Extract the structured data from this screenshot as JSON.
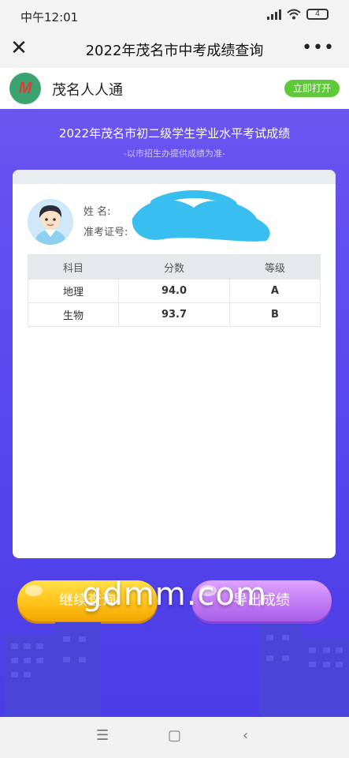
{
  "status_bar": {
    "time": "中午12:01",
    "battery": "4"
  },
  "nav": {
    "title": "2022年茂名市中考成绩查询",
    "more": "•••"
  },
  "app_banner": {
    "logo_text": "M",
    "app_name": "茂名人人通",
    "open_label": "立即打开"
  },
  "header": {
    "title": "2022年茂名市初二级学生学业水平考试成绩",
    "subtitle": "-以市招生办提供成绩为准-"
  },
  "student": {
    "name_label": "姓      名:",
    "id_label": "准考证号:"
  },
  "table": {
    "columns": [
      "科目",
      "分数",
      "等级"
    ],
    "rows": [
      [
        "地理",
        "94.0",
        "A"
      ],
      [
        "生物",
        "93.7",
        "B"
      ]
    ]
  },
  "buttons": {
    "continue_label": "继续查询",
    "export_label": "导出成绩"
  },
  "watermark": "gdmm.com",
  "colors": {
    "accent": "#5a48ee",
    "continue": "#ffc21a",
    "export": "#c27af5",
    "open": "#5fc93a"
  }
}
